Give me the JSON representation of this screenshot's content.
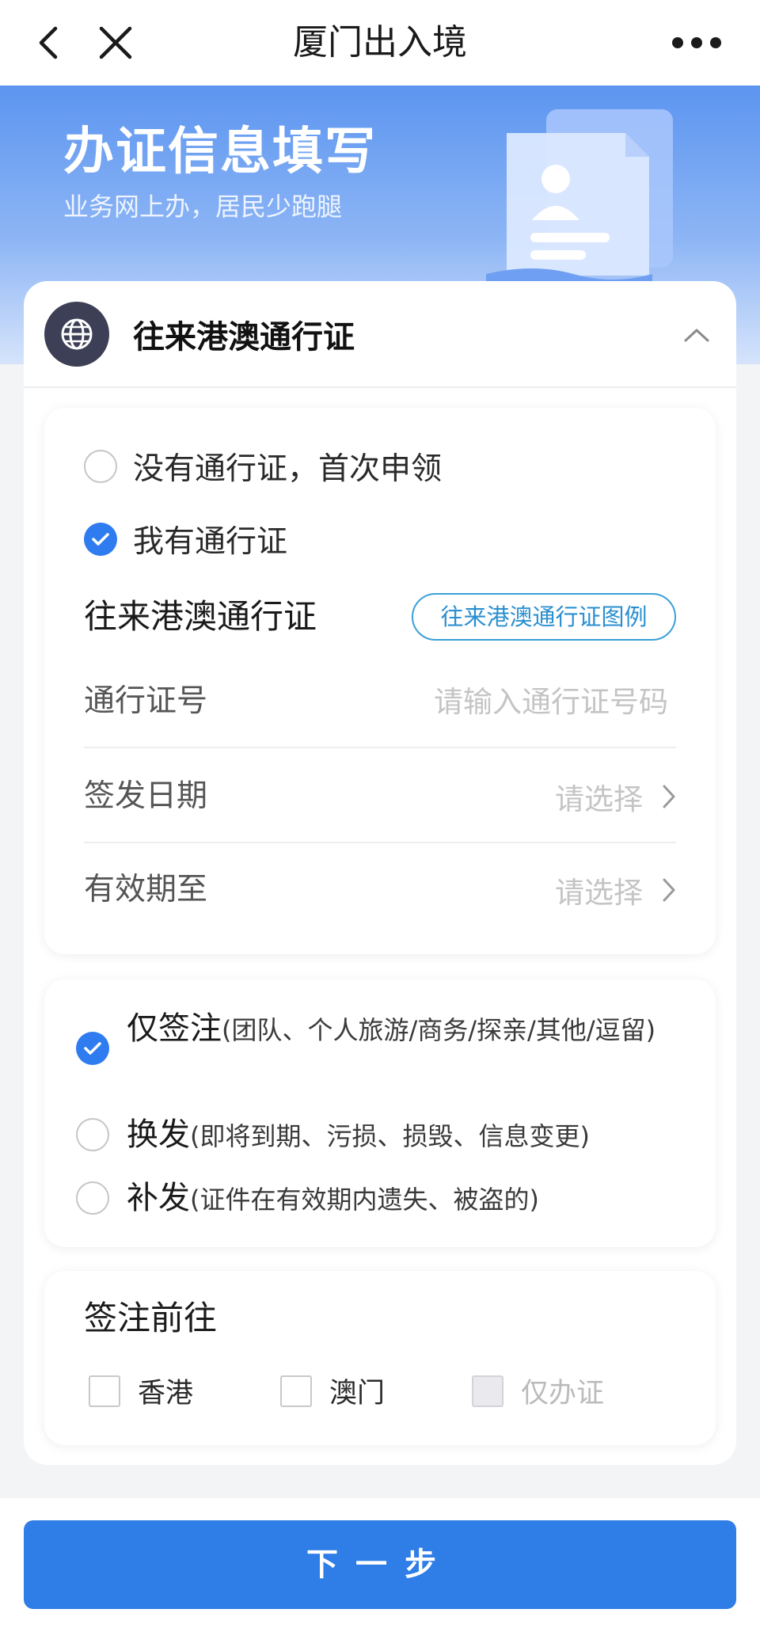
{
  "navbar": {
    "title": "厦门出入境",
    "back_icon": "chevron-left-icon",
    "close_icon": "close-icon",
    "more_icon": "more-dots-icon"
  },
  "banner": {
    "title": "办证信息填写",
    "subtitle": "业务网上办，居民少跑腿",
    "illustration_icon": "id-document-icon"
  },
  "card": {
    "title": "往来港澳通行证",
    "badge_icon": "globe-icon",
    "collapse_icon": "chevron-up-icon"
  },
  "pass_status": {
    "options": [
      {
        "label": "没有通行证，首次申领",
        "checked": false
      },
      {
        "label": "我有通行证",
        "checked": true
      }
    ]
  },
  "pass_info": {
    "heading": "往来港澳通行证",
    "example_button": "往来港澳通行证图例",
    "fields": {
      "number": {
        "label": "通行证号",
        "placeholder": "请输入通行证号码",
        "value": ""
      },
      "issue_date": {
        "label": "签发日期",
        "value": "请选择"
      },
      "expiry_date": {
        "label": "有效期至",
        "value": "请选择"
      }
    }
  },
  "service_type": {
    "options": [
      {
        "main": "仅签注",
        "note": "(团队、个人旅游/商务/探亲/其他/逗留)",
        "checked": true
      },
      {
        "main": "换发",
        "note": "(即将到期、污损、损毁、信息变更)",
        "checked": false
      },
      {
        "main": "补发",
        "note": "(证件在有效期内遗失、被盗的)",
        "checked": false
      }
    ]
  },
  "destination": {
    "title": "签注前往",
    "options": [
      {
        "label": "香港",
        "checked": false,
        "disabled": false
      },
      {
        "label": "澳门",
        "checked": false,
        "disabled": false
      },
      {
        "label": "仅办证",
        "checked": false,
        "disabled": true
      }
    ]
  },
  "footer": {
    "next_label": "下一步"
  },
  "colors": {
    "primary": "#2f7de6",
    "check": "#2f7bf0",
    "link_border": "#3aa0d8",
    "banner_top": "#5c95f0"
  }
}
